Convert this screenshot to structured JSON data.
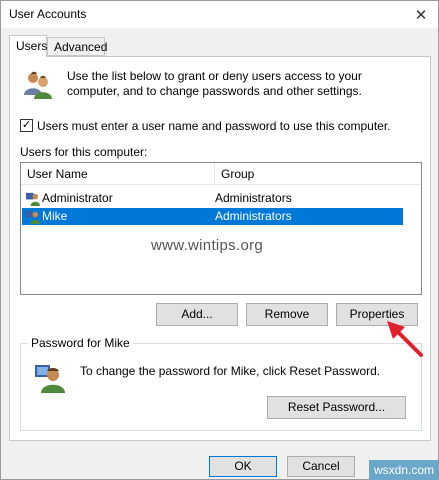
{
  "window": {
    "title": "User Accounts"
  },
  "tabs": [
    {
      "label": "Users"
    },
    {
      "label": "Advanced"
    }
  ],
  "intro": {
    "text": "Use the list below to grant or deny users access to your computer, and to change passwords and other settings."
  },
  "require_login": {
    "checked": true,
    "label": "Users must enter a user name and password to use this computer."
  },
  "users_list": {
    "label": "Users for this computer:",
    "columns": [
      "User Name",
      "Group"
    ],
    "rows": [
      {
        "name": "Administrator",
        "group": "Administrators"
      },
      {
        "name": "Mike",
        "group": "Administrators"
      }
    ],
    "selected_index": 1
  },
  "watermark": "www.wintips.org",
  "actions": {
    "add": "Add...",
    "remove": "Remove",
    "properties": "Properties"
  },
  "password_box": {
    "legend": "Password for Mike",
    "text": "To change the password for Mike, click Reset Password.",
    "reset_button": "Reset Password..."
  },
  "footer": {
    "ok": "OK",
    "cancel": "Cancel",
    "badge": "wsxdn.com"
  },
  "colors": {
    "selection": "#0078d7",
    "arrow": "#e0202a"
  },
  "icons": {
    "users": "users-icon",
    "user": "user-icon",
    "close": "close-icon",
    "check": "checkmark-icon",
    "arrow": "red-arrow-icon"
  }
}
